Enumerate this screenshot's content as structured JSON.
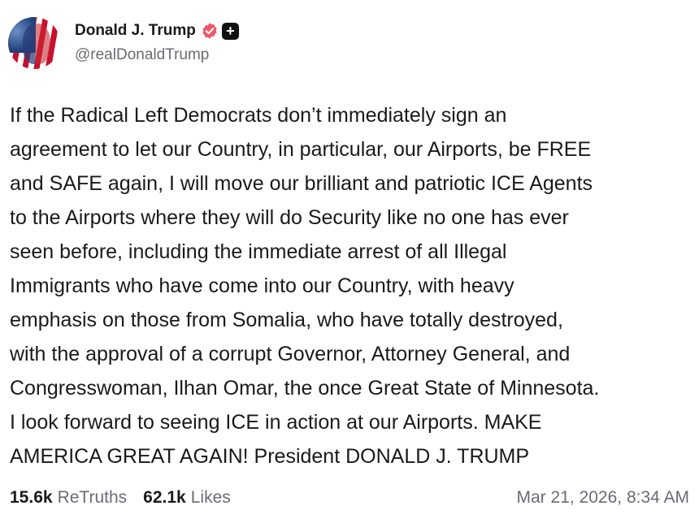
{
  "author": {
    "display_name": "Donald J. Trump",
    "handle": "@realDonaldTrump",
    "avatar_icon": "profile-photo-flag",
    "verified_icon": "verified-badge-icon",
    "verified_color": "#f0566b",
    "plus_icon": "plus-badge-icon"
  },
  "post": {
    "text": "If the Radical Left Democrats don’t immediately sign an\nagreement to let our Country, in particular, our Airports, be FREE\nand SAFE again, I will move our brilliant and patriotic ICE Agents\nto the Airports where they will do Security like no one has ever\nseen before, including the immediate arrest of all Illegal\nImmigrants who have come into our Country, with heavy\nemphasis on those from Somalia, who have totally destroyed,\nwith the approval of a corrupt Governor, Attorney General, and\nCongresswoman, Ilhan Omar, the once Great State of Minnesota.\nI look forward to seeing ICE in action at our Airports. MAKE\nAMERICA GREAT AGAIN! President DONALD J. TRUMP"
  },
  "stats": {
    "retruths_count": "15.6k",
    "retruths_label": "ReTruths",
    "likes_count": "62.1k",
    "likes_label": "Likes"
  },
  "timestamp": "Mar 21, 2026, 8:34 AM"
}
